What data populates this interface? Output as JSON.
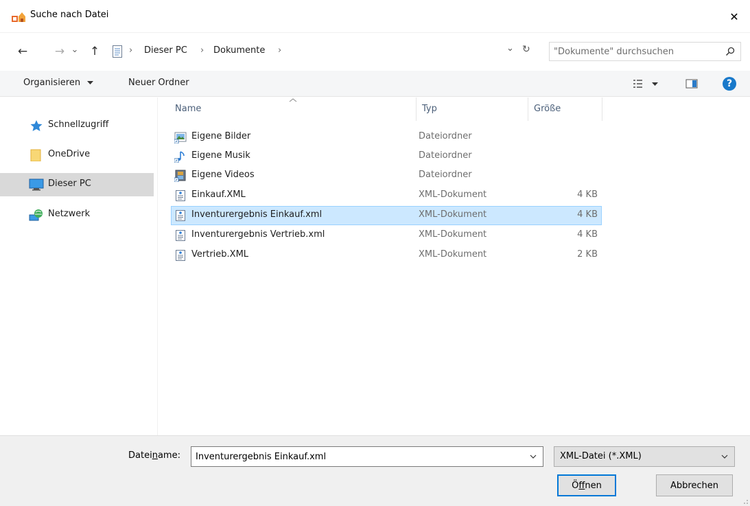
{
  "window": {
    "title": "Suche nach Datei",
    "close_glyph": "✕"
  },
  "nav": {
    "back_glyph": "←",
    "forward_glyph": "→",
    "recent_glyph": "⌄",
    "up_glyph": "↑"
  },
  "address": {
    "separator": "›",
    "crumbs": [
      "Dieser PC",
      "Dokumente"
    ],
    "dropdown_glyph": "⌄",
    "refresh_glyph": "↻"
  },
  "search": {
    "placeholder": "\"Dokumente\" durchsuchen"
  },
  "toolbar": {
    "organize_label": "Organisieren",
    "new_folder_label": "Neuer Ordner",
    "help_glyph": "?"
  },
  "sidebar": {
    "items": [
      {
        "label": "Schnellzugriff",
        "icon": "star-icon"
      },
      {
        "label": "OneDrive",
        "icon": "folder-icon"
      },
      {
        "label": "Dieser PC",
        "icon": "monitor-icon",
        "selected": true
      },
      {
        "label": "Netzwerk",
        "icon": "network-icon"
      }
    ]
  },
  "columns": {
    "name": "Name",
    "type": "Typ",
    "size": "Größe"
  },
  "files": [
    {
      "name": "Eigene Bilder",
      "type": "Dateiordner",
      "size": "",
      "icon": "pictures-folder-icon"
    },
    {
      "name": "Eigene Musik",
      "type": "Dateiordner",
      "size": "",
      "icon": "music-folder-icon"
    },
    {
      "name": "Eigene Videos",
      "type": "Dateiordner",
      "size": "",
      "icon": "videos-folder-icon"
    },
    {
      "name": "Einkauf.XML",
      "type": "XML-Dokument",
      "size": "4 KB",
      "icon": "xml-file-icon"
    },
    {
      "name": "Inventurergebnis Einkauf.xml",
      "type": "XML-Dokument",
      "size": "4 KB",
      "icon": "xml-file-icon",
      "selected": true
    },
    {
      "name": "Inventurergebnis Vertrieb.xml",
      "type": "XML-Dokument",
      "size": "4 KB",
      "icon": "xml-file-icon"
    },
    {
      "name": "Vertrieb.XML",
      "type": "XML-Dokument",
      "size": "2 KB",
      "icon": "xml-file-icon"
    }
  ],
  "bottom": {
    "filename_label_pre": "Datei",
    "filename_label_u": "n",
    "filename_label_post": "ame:",
    "filename_value": "Inventurergebnis Einkauf.xml",
    "filetype_value": "XML-Datei (*.XML)",
    "open_pre": "Ö",
    "open_u": "f",
    "open_post": "fnen",
    "cancel_label": "Abbrechen"
  },
  "colors": {
    "accent": "#0078d7",
    "selection_bg": "#cce8ff",
    "selection_border": "#99d1ff",
    "help_blue": "#1979ca"
  }
}
